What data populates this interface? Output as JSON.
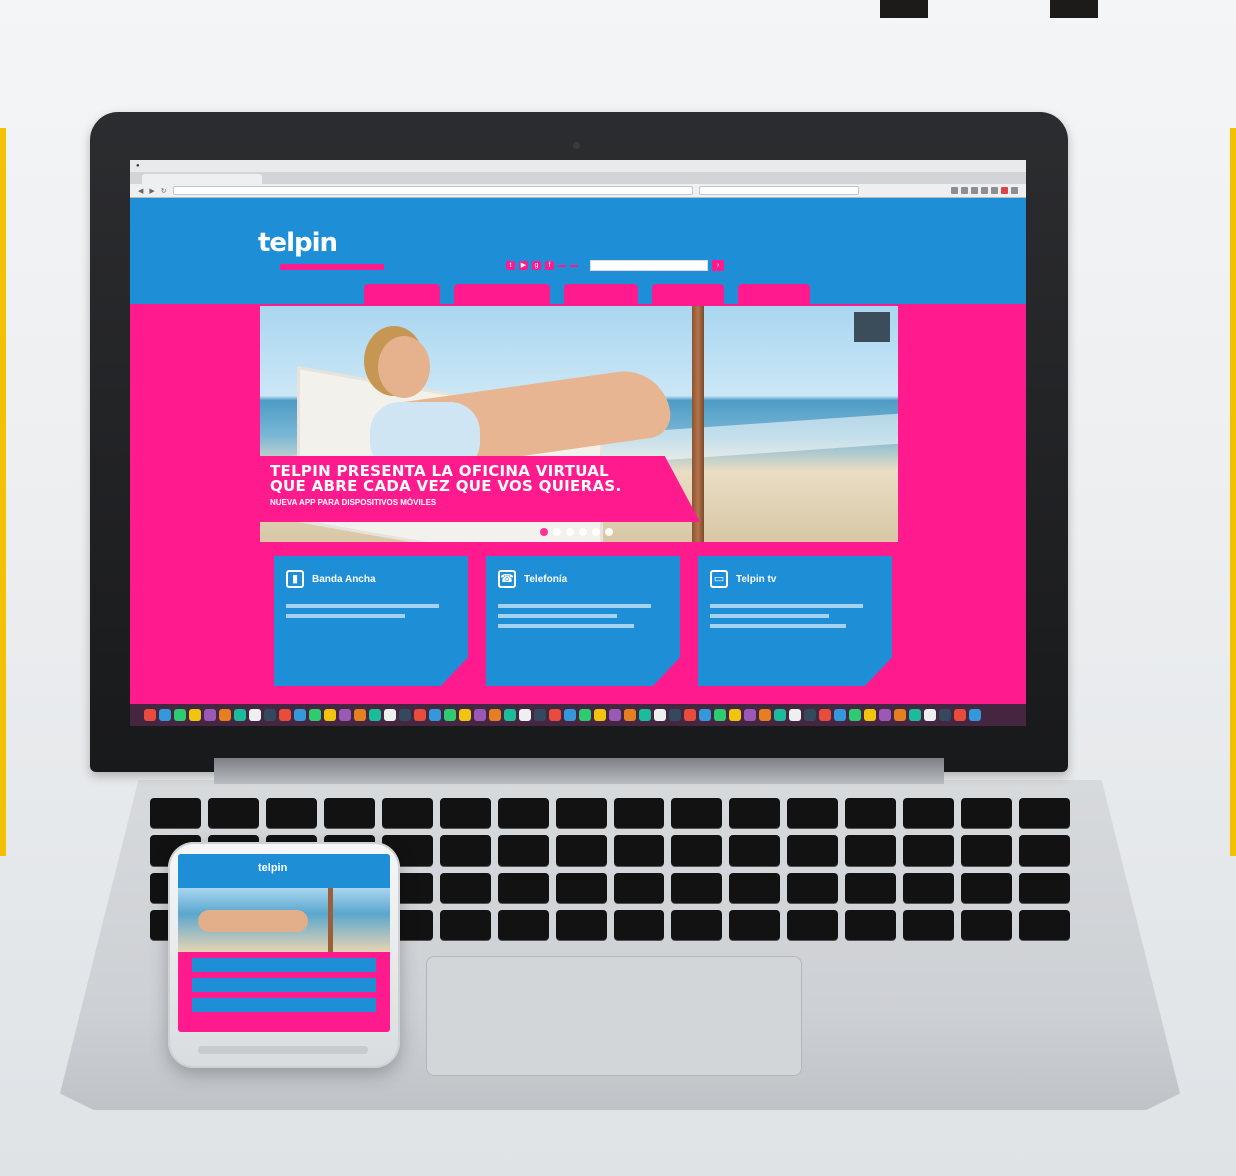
{
  "website": {
    "logo": "telpin",
    "hero": {
      "headline_line1": "TELPIN PRESENTA LA OFICINA VIRTUAL",
      "headline_line2": "QUE ABRE CADA VEZ QUE VOS QUIERAS.",
      "subheadline": "NUEVA APP PARA DISPOSITIVOS MÓVILES"
    },
    "cards": [
      {
        "title": "Banda Ancha",
        "icon": "modem-icon"
      },
      {
        "title": "Telefonía",
        "icon": "phone-icon"
      },
      {
        "title": "Telpin tv",
        "icon": "tv-icon"
      }
    ]
  },
  "phone": {
    "logo": "telpin"
  },
  "colors": {
    "brand_blue": "#1e8fd6",
    "brand_pink": "#ff1b8d",
    "accent_yellow": "#f2c200"
  }
}
